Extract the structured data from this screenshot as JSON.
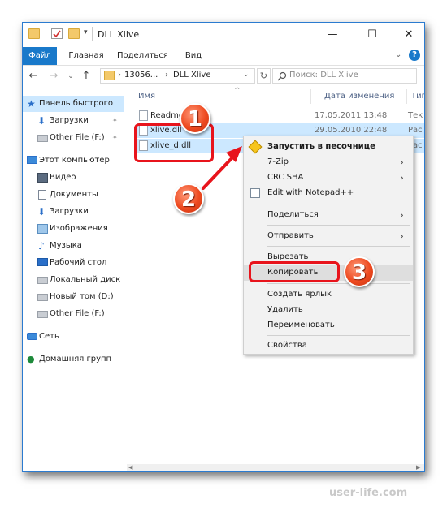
{
  "window": {
    "title": "DLL Xlive"
  },
  "ribbon": {
    "tabs": [
      "Файл",
      "Главная",
      "Поделиться",
      "Вид"
    ]
  },
  "address": {
    "parent": "13056...",
    "separator": "›",
    "current": "DLL Xlive"
  },
  "search": {
    "placeholder": "Поиск: DLL Xlive"
  },
  "sidebar": {
    "items": [
      {
        "label": "Панель быстрого",
        "icon": "star-icon"
      },
      {
        "label": "Загрузки",
        "icon": "download-icon"
      },
      {
        "label": "Other File (F:)",
        "icon": "drive-icon"
      },
      {
        "label": "Этот компьютер",
        "icon": "computer-icon"
      },
      {
        "label": "Видео",
        "icon": "video-icon"
      },
      {
        "label": "Документы",
        "icon": "documents-icon"
      },
      {
        "label": "Загрузки",
        "icon": "download-icon"
      },
      {
        "label": "Изображения",
        "icon": "pictures-icon"
      },
      {
        "label": "Музыка",
        "icon": "music-icon"
      },
      {
        "label": "Рабочий стол",
        "icon": "desktop-icon"
      },
      {
        "label": "Локальный диск",
        "icon": "drive-icon"
      },
      {
        "label": "Новый том (D:)",
        "icon": "drive-icon"
      },
      {
        "label": "Other File (F:)",
        "icon": "drive-icon"
      },
      {
        "label": "Сеть",
        "icon": "network-icon"
      },
      {
        "label": "Домашняя групп",
        "icon": "homegroup-icon"
      }
    ]
  },
  "columns": {
    "name": "Имя",
    "date": "Дата изменения",
    "type": "Тип"
  },
  "files": [
    {
      "name": "Readme",
      "date": "17.05.2011 13:48",
      "type": "Тек"
    },
    {
      "name": "xlive.dll",
      "date": "29.05.2010 22:48",
      "type": "Рас"
    },
    {
      "name": "xlive_d.dll",
      "date": "",
      "type": "Рас"
    }
  ],
  "context_menu": {
    "items": [
      {
        "label": "Запустить в песочнице",
        "bold": true
      },
      {
        "label": "7-Zip",
        "submenu": true
      },
      {
        "label": "CRC SHA",
        "submenu": true
      },
      {
        "label": "Edit with Notepad++"
      },
      {
        "label": "Поделиться",
        "submenu": true
      },
      {
        "label": "Отправить",
        "submenu": true
      },
      {
        "label": "Вырезать"
      },
      {
        "label": "Копировать"
      },
      {
        "label": "Создать ярлык"
      },
      {
        "label": "Удалить"
      },
      {
        "label": "Переименовать"
      },
      {
        "label": "Свойства"
      }
    ]
  },
  "annotations": {
    "badge1": "1",
    "badge2": "2",
    "badge3": "3",
    "color": "#e8141c"
  },
  "watermark": "user-life.com"
}
